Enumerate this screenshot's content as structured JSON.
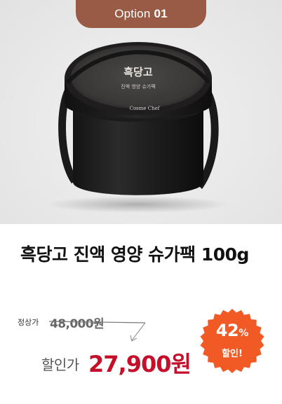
{
  "option_tab": {
    "word": "Option",
    "number": "01"
  },
  "product_image": {
    "lid_logo_text": "흑당고",
    "lid_sub_text": "진액 영양 슈가팩",
    "brand_text": "Cosme Chef"
  },
  "product": {
    "title": "흑당고 진액 영양 슈가팩 100g"
  },
  "pricing": {
    "regular_label": "정상가",
    "regular_price": "48,000원",
    "sale_label": "할인가",
    "sale_price": "27,900원"
  },
  "discount_badge": {
    "percent": "42",
    "percent_sign": "%",
    "label": "할인!",
    "color": "#f15a24"
  },
  "colors": {
    "tab": "#9a5b46",
    "sale_price": "#c4102a",
    "badge": "#f15a24"
  }
}
